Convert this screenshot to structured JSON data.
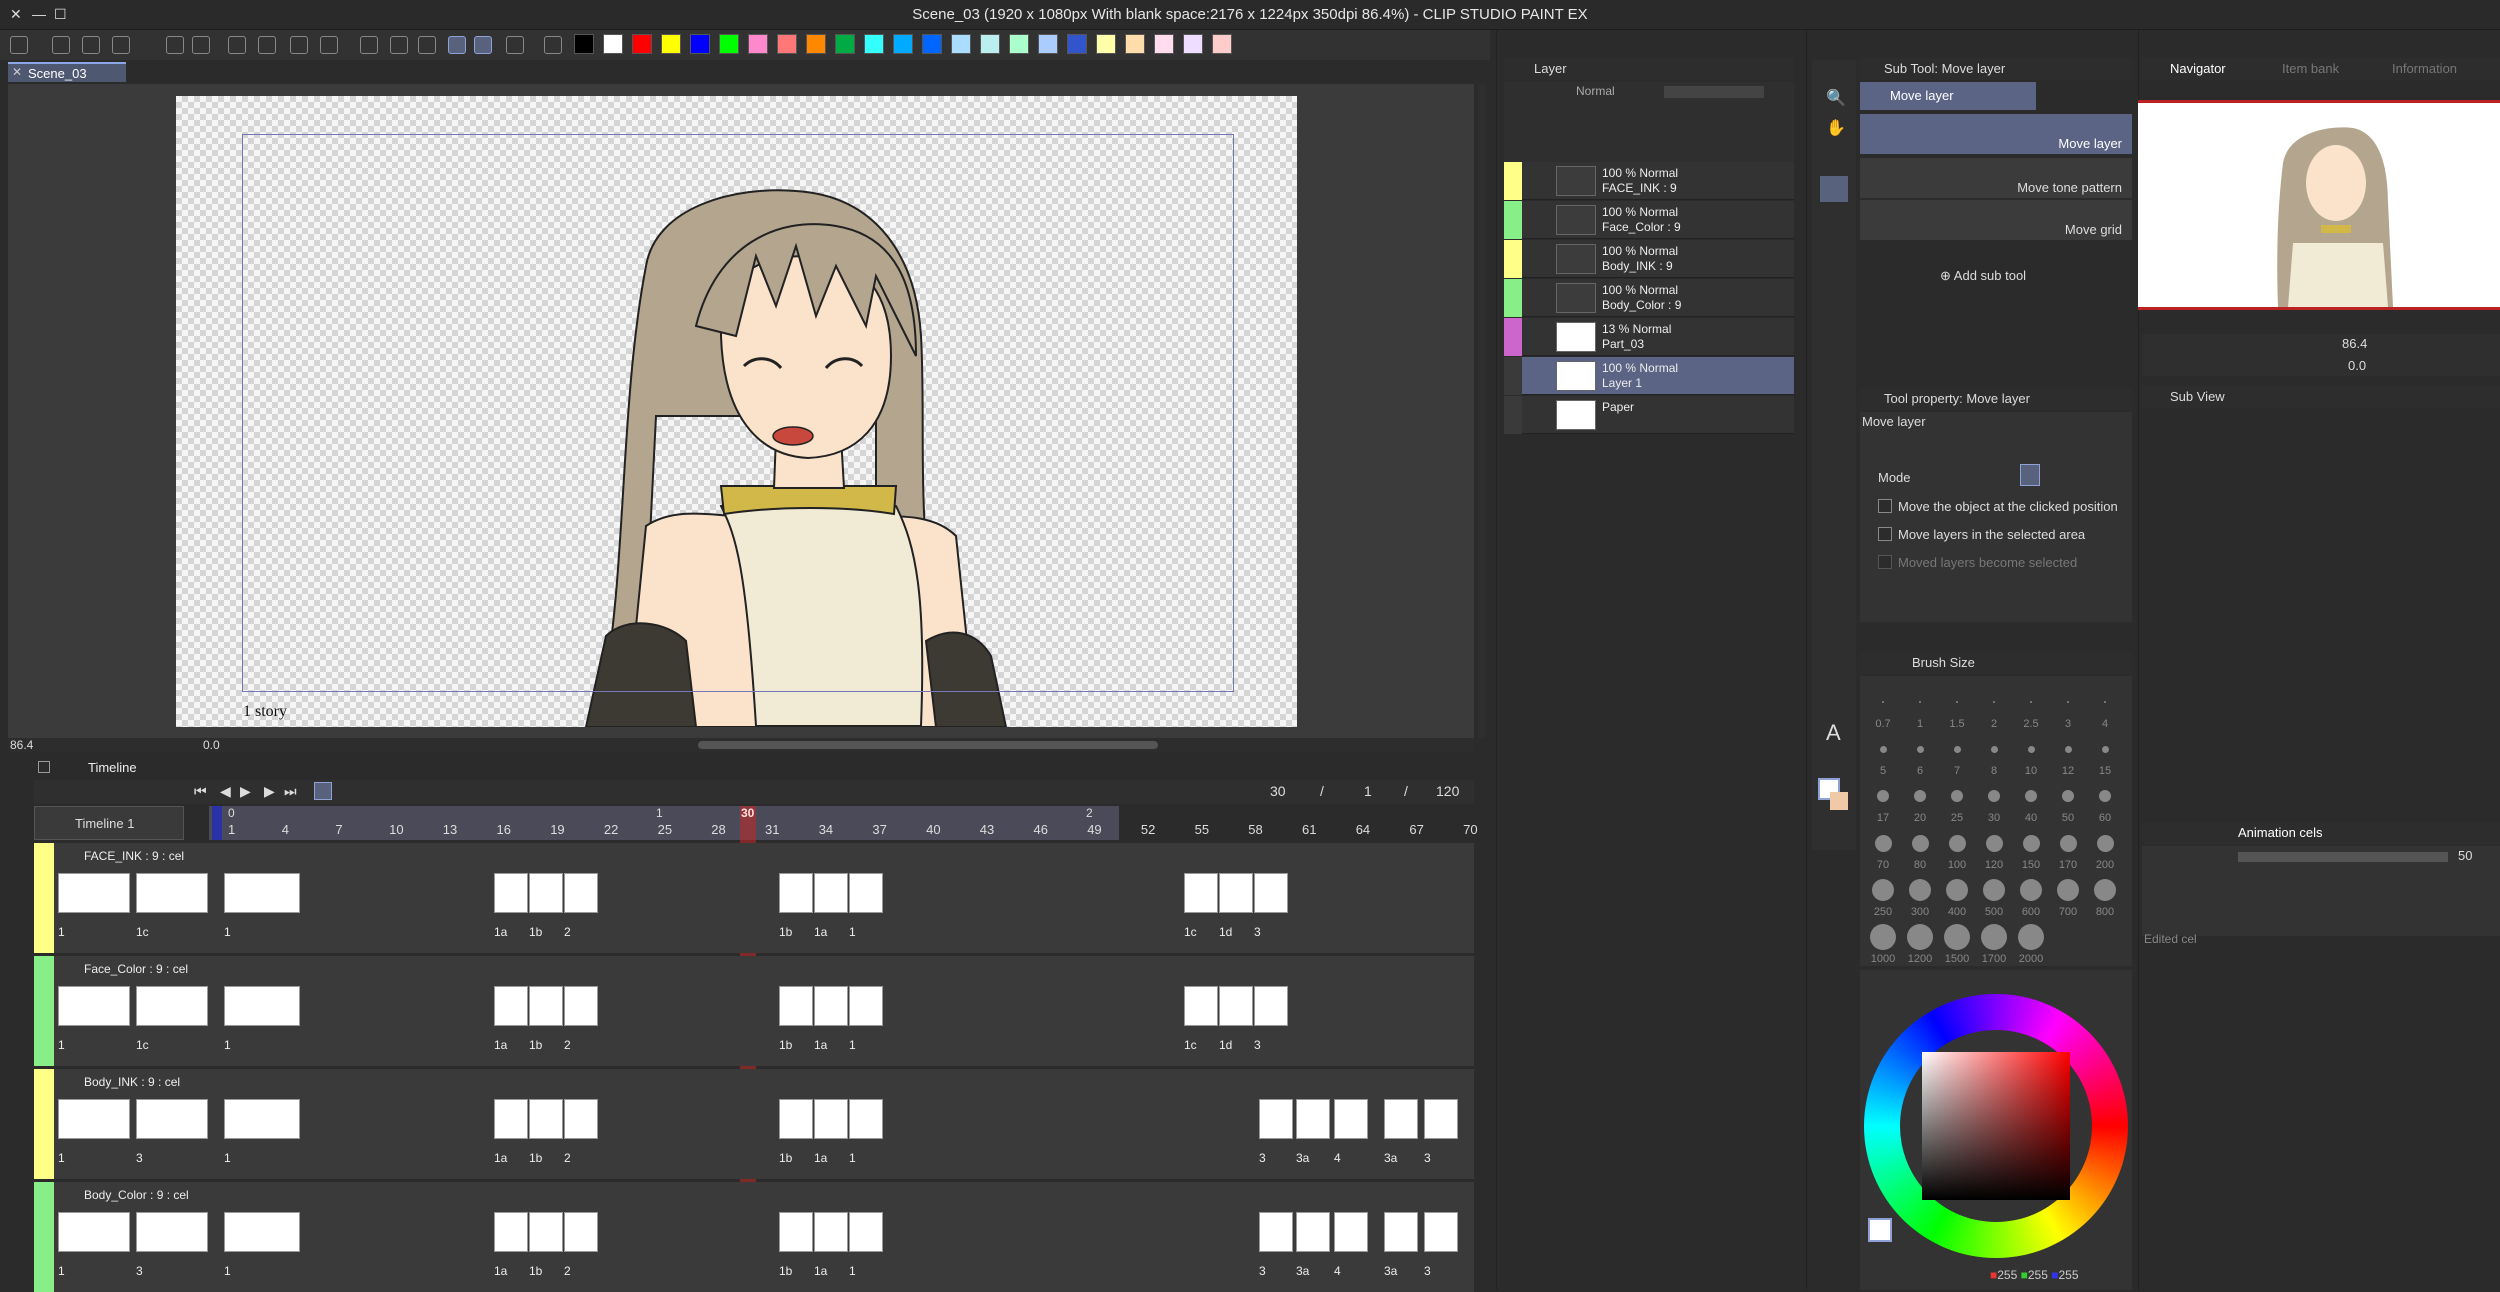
{
  "window": {
    "title": "Scene_03 (1920 x 1080px With blank space:2176 x 1224px 350dpi 86.4%)  - CLIP STUDIO PAINT EX"
  },
  "document_tab": {
    "label": "Scene_03"
  },
  "canvas": {
    "story_label": "1 story"
  },
  "status": {
    "zoom": "86.4",
    "rotation": "0.0"
  },
  "colors": [
    "#000000",
    "#ffffff",
    "#ff0000",
    "#ffff00",
    "#0000ff",
    "#00ff00",
    "#ff88cc",
    "#ff7777",
    "#ff8800",
    "#00aa44",
    "#33ffff",
    "#00aaff",
    "#0066ff",
    "#aaddff",
    "#bbeeee",
    "#aaffcc",
    "#aaccff",
    "#3355cc",
    "#ffffaa",
    "#ffddaa",
    "#ffddee",
    "#eeddff",
    "#ffcccc"
  ],
  "timeline": {
    "title": "Timeline",
    "name": "Timeline 1",
    "current_frame": "30",
    "slash1": "/",
    "frame_a": "1",
    "slash2": "/",
    "total_frames": "120",
    "ruler": [
      "1",
      "4",
      "7",
      "10",
      "13",
      "16",
      "19",
      "22",
      "25",
      "28",
      "31",
      "34",
      "37",
      "40",
      "43",
      "46",
      "49",
      "52",
      "55",
      "58",
      "61",
      "64",
      "67",
      "70"
    ],
    "marker_0": "0",
    "marker_1": "1",
    "marker_2": "2",
    "marker_30": "30",
    "tracks": [
      {
        "name": "FACE_INK : 9 : cel",
        "color": "#ffff88",
        "labels_left": [
          "1",
          "1c"
        ],
        "labels": [
          "1",
          "1a",
          "1b",
          "2",
          "1b",
          "1a",
          "1",
          "1c",
          "1d",
          "3"
        ]
      },
      {
        "name": "Face_Color : 9 : cel",
        "color": "#88ee88",
        "labels_left": [
          "1",
          "1c"
        ],
        "labels": [
          "1",
          "1a",
          "1b",
          "2",
          "1b",
          "1a",
          "1",
          "1c",
          "1d",
          "3"
        ]
      },
      {
        "name": "Body_INK : 9 : cel",
        "color": "#ffff88",
        "labels_left": [
          "1",
          "3"
        ],
        "labels": [
          "1",
          "1a",
          "1b",
          "2",
          "1b",
          "1a",
          "1",
          "3",
          "3a",
          "4",
          "3a",
          "3"
        ]
      },
      {
        "name": "Body_Color : 9 : cel",
        "color": "#88ee88",
        "labels_left": [
          "1",
          "3"
        ],
        "labels": [
          "1",
          "1a",
          "1b",
          "2",
          "1b",
          "1a",
          "1",
          "3",
          "3a",
          "4",
          "3a",
          "3"
        ]
      }
    ]
  },
  "layer_panel": {
    "title": "Layer",
    "blend_mode": "Normal",
    "layers": [
      {
        "line1": "100 %  Normal",
        "line2": "FACE_INK : 9",
        "color": "#ffff88"
      },
      {
        "line1": "100 %  Normal",
        "line2": "Face_Color : 9",
        "color": "#88ee88"
      },
      {
        "line1": "100 %  Normal",
        "line2": "Body_INK : 9",
        "color": "#ffff88"
      },
      {
        "line1": "100 %  Normal",
        "line2": "Body_Color : 9",
        "color": "#88ee88"
      },
      {
        "line1": "13 %  Normal",
        "line2": "Part_03",
        "color": "#cc66cc"
      },
      {
        "line1": "100 %  Normal",
        "line2": "Layer 1",
        "color": "#3a3a3a"
      },
      {
        "line1": "",
        "line2": "Paper",
        "color": "#3a3a3a"
      }
    ]
  },
  "sub_tool": {
    "title": "Sub Tool: Move layer",
    "group": "Move layer",
    "items": [
      "Move layer",
      "Move tone pattern",
      "Move grid"
    ],
    "add": "Add sub tool"
  },
  "tool_property": {
    "title": "Tool property: Move layer",
    "name": "Move layer",
    "mode_label": "Mode",
    "options": [
      "Move the object at the clicked position",
      "Move layers in the selected area",
      "Moved layers become selected"
    ]
  },
  "brush_size": {
    "title": "Brush Size",
    "sizes": [
      "0.7",
      "1",
      "1.5",
      "2",
      "2.5",
      "3",
      "4",
      "5",
      "6",
      "7",
      "8",
      "10",
      "12",
      "15",
      "17",
      "20",
      "25",
      "30",
      "40",
      "50",
      "60",
      "70",
      "80",
      "100",
      "120",
      "150",
      "170",
      "200",
      "250",
      "300",
      "400",
      "500",
      "600",
      "700",
      "800",
      "1000",
      "1200",
      "1500",
      "1700",
      "2000"
    ]
  },
  "navigator": {
    "tabs": [
      "Navigator",
      "Item bank",
      "Information"
    ],
    "zoom": "86.4",
    "rotation": "0.0"
  },
  "sub_view": {
    "title": "Sub View"
  },
  "animation_cels": {
    "title": "Animation cels",
    "opacity": "50",
    "status": "Edited cel"
  },
  "color_wheel": {
    "r": "255",
    "g": "255",
    "b": "255"
  }
}
